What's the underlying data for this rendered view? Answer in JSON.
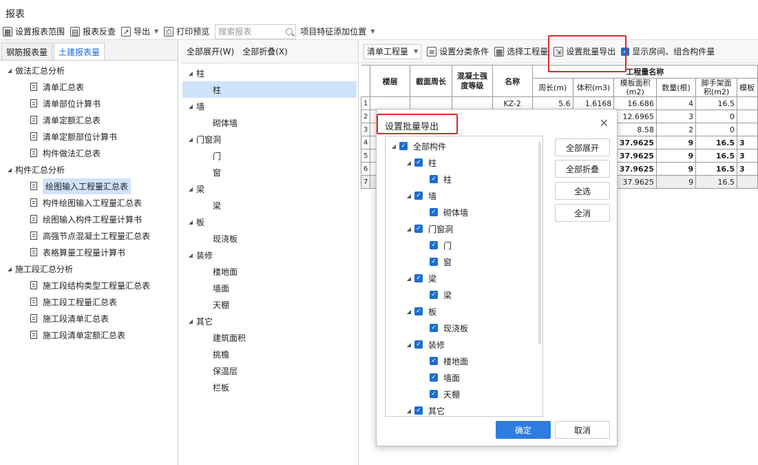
{
  "window": {
    "title": "报表"
  },
  "toolbar": {
    "set_range": "设置报表范围",
    "reverse_check": "报表反查",
    "export": "导出",
    "print_preview": "打印预览",
    "search_placeholder": "搜索报表",
    "add_feature": "项目特征添加位置"
  },
  "left": {
    "tabs": [
      "钢筋报表量",
      "土建报表量"
    ],
    "groups": [
      {
        "label": "做法汇总分析",
        "items": [
          "清单汇总表",
          "清单部位计算书",
          "清单定额汇总表",
          "清单定额部位计算书",
          "构件做法汇总表"
        ]
      },
      {
        "label": "构件汇总分析",
        "items": [
          "绘图输入工程量汇总表",
          "构件绘图输入工程量汇总表",
          "绘图输入构件工程量计算书",
          "高强节点混凝土工程量汇总表",
          "表格算量工程量计算书"
        ]
      },
      {
        "label": "施工段汇总分析",
        "items": [
          "施工段结构类型工程量汇总表",
          "施工段工程量汇总表",
          "施工段清单汇总表",
          "施工段清单定额汇总表"
        ]
      }
    ]
  },
  "middle": {
    "expand_all": "全部展开(W)",
    "collapse_all": "全部折叠(X)",
    "groups": [
      {
        "label": "柱",
        "items": [
          "柱"
        ]
      },
      {
        "label": "墙",
        "items": [
          "砌体墙"
        ]
      },
      {
        "label": "门窗洞",
        "items": [
          "门",
          "窗"
        ]
      },
      {
        "label": "梁",
        "items": [
          "梁"
        ]
      },
      {
        "label": "板",
        "items": [
          "现浇板"
        ]
      },
      {
        "label": "装修",
        "items": [
          "楼地面",
          "墙面",
          "天棚"
        ]
      },
      {
        "label": "其它",
        "items": [
          "建筑面积",
          "挑檐",
          "保温层",
          "栏板"
        ]
      }
    ]
  },
  "right": {
    "combo": "清单工程量",
    "set_category": "设置分类条件",
    "select_qty": "选择工程量",
    "batch_export": "设置批量导出",
    "show_room": "显示房间、组合构件量",
    "table": {
      "headers": {
        "floor": "楼层",
        "perimeter": "截面周长",
        "concrete": "混凝土强度等级",
        "name": "名称",
        "qty_name": "工程量名称"
      },
      "sub_headers": [
        "周长(m)",
        "体积(m3)",
        "模板面积(m2)",
        "数量(根)",
        "脚手架面积(m2)",
        "模板"
      ],
      "row_numbers": [
        "1",
        "2",
        "3",
        "4",
        "5",
        "6",
        "7"
      ],
      "rows": [
        [
          "KZ-2",
          "5.6",
          "1.6168",
          "16.686",
          "4",
          "16.5"
        ],
        [
          "",
          "",
          "",
          "12.6965",
          "3",
          "0"
        ],
        [
          "",
          "",
          "",
          "8.58",
          "2",
          "0"
        ],
        [
          "",
          "",
          "",
          "37.9625",
          "9",
          "16.5"
        ],
        [
          "",
          "",
          "",
          "37.9625",
          "9",
          "16.5"
        ],
        [
          "",
          "",
          "",
          "37.9625",
          "9",
          "16.5"
        ],
        [
          "",
          "",
          "",
          "37.9625",
          "9",
          "16.5"
        ]
      ],
      "edge_values": [
        "3",
        "3",
        "3"
      ]
    }
  },
  "dialog": {
    "title": "设置批量导出",
    "root": "全部构件",
    "groups": [
      {
        "label": "柱",
        "items": [
          "柱"
        ]
      },
      {
        "label": "墙",
        "items": [
          "砌体墙"
        ]
      },
      {
        "label": "门窗洞",
        "items": [
          "门",
          "窗"
        ]
      },
      {
        "label": "梁",
        "items": [
          "梁"
        ]
      },
      {
        "label": "板",
        "items": [
          "现浇板"
        ]
      },
      {
        "label": "装修",
        "items": [
          "楼地面",
          "墙面",
          "天棚"
        ]
      },
      {
        "label": "其它",
        "items": []
      }
    ],
    "buttons": {
      "expand_all": "全部展开",
      "collapse_all": "全部折叠",
      "select_all": "全选",
      "deselect_all": "全消",
      "ok": "确定",
      "cancel": "取消"
    },
    "colors": {
      "accent": "#2d7ce0",
      "highlight": "#e0282d"
    }
  }
}
